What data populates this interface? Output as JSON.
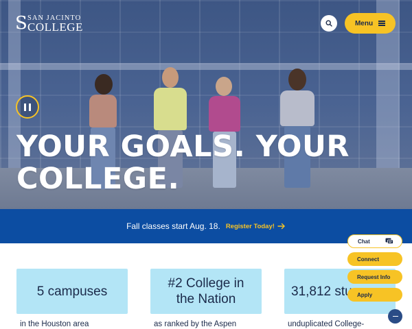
{
  "header": {
    "logo_top": "SAN JACINTO",
    "logo_bottom": "COLLEGE",
    "logo_mark": "S",
    "menu_label": "Menu"
  },
  "hero": {
    "headline": "YOUR GOALS. YOUR COLLEGE.",
    "pause_icon": "pause-icon"
  },
  "announcement": {
    "text": "Fall classes start Aug. 18.",
    "link_label": "Register Today!"
  },
  "stats": [
    {
      "value": "5 campuses",
      "caption": "in the Houston area"
    },
    {
      "value": "#2 College in the Nation",
      "caption": "as ranked by the Aspen"
    },
    {
      "value": "31,812 stu",
      "caption": "unduplicated College-"
    }
  ],
  "floating_actions": {
    "chat": "Chat",
    "connect": "Connect",
    "request_info": "Request Info",
    "apply": "Apply"
  },
  "colors": {
    "brand_blue": "#0c4da2",
    "accent_yellow": "#f7c325",
    "card_blue": "#b3e5f6",
    "navy_text": "#1b2a4a"
  },
  "icons": [
    "search-icon",
    "hamburger-icon",
    "pause-icon",
    "arrow-right-icon",
    "chat-icon",
    "collapse-icon"
  ]
}
